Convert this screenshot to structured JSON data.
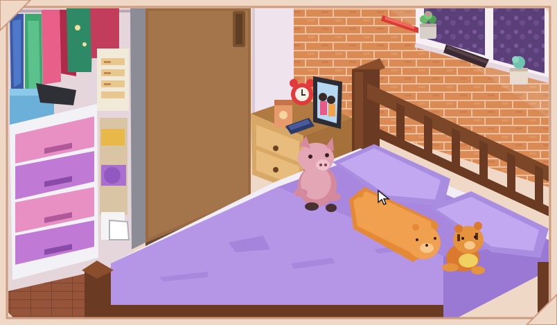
{
  "scene": {
    "room": "bedroom",
    "palette": {
      "frame": "#efd8c6",
      "frame_border": "#cc9c80",
      "brick": "#d98a55",
      "mortar": "#efbe9a",
      "wall": "#efe3ee",
      "floor": "#96543a",
      "bed_wood": "#6a3a22",
      "blanket": "#b596e6",
      "blanket_shade": "#9a79d4",
      "pillow": "#a88de0",
      "sheet": "#f2eef8",
      "nightstand": "#d8a866",
      "wardrobe": "#9a6a42",
      "drawer_pink": "#e890c4",
      "drawer_purple": "#c07ad6",
      "pig": "#e3a6b4",
      "cat_pillow": "#f0a04e",
      "bear": "#e6933e",
      "night_sky": "#5a3f78"
    },
    "icons": [
      "cursor-arrow-icon"
    ]
  }
}
